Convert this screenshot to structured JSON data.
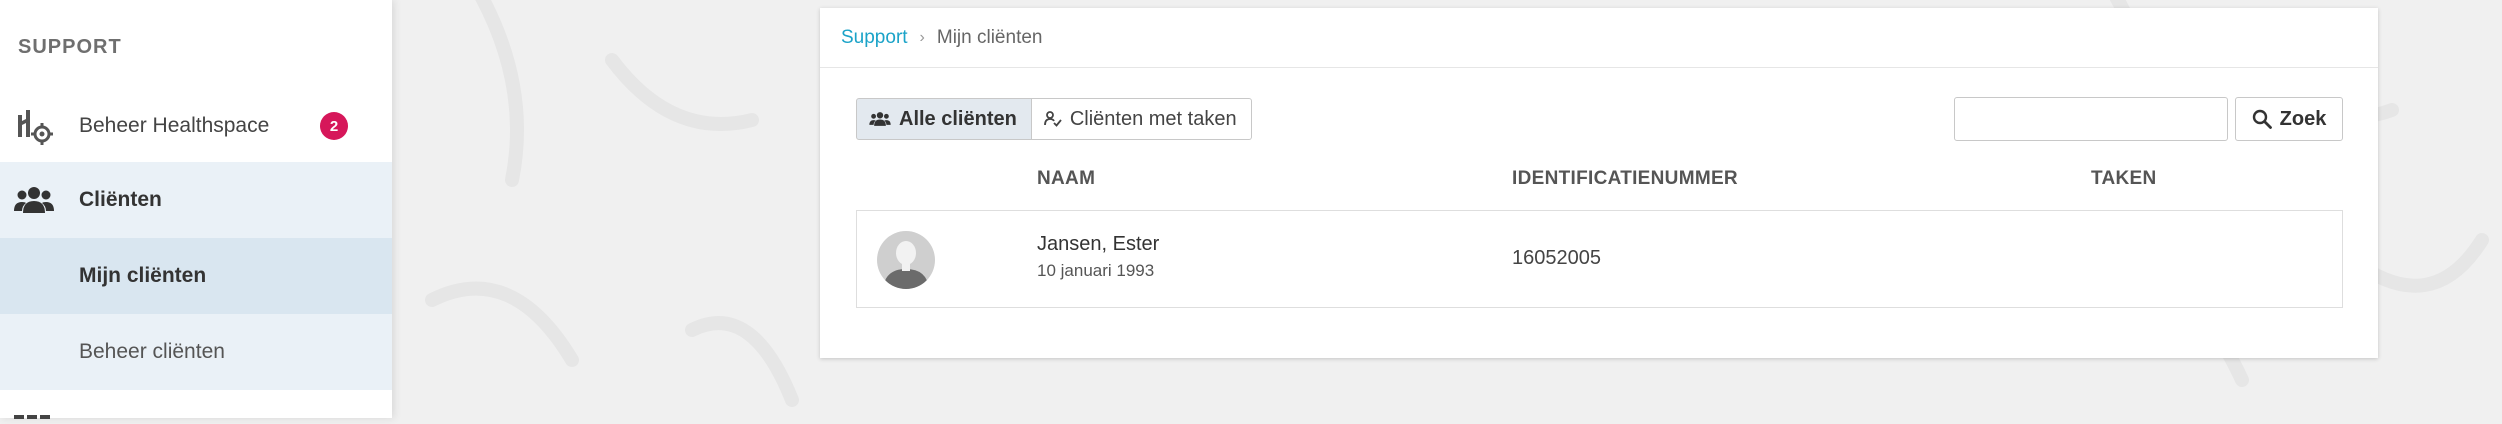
{
  "sidebar": {
    "heading": "SUPPORT",
    "items": [
      {
        "label": "Beheer Healthspace",
        "icon": "healthspace-gear-icon",
        "badge": "2"
      },
      {
        "label": "Cliënten",
        "icon": "users-icon"
      },
      {
        "label": "Mijn cliënten"
      },
      {
        "label": "Beheer cliënten"
      }
    ]
  },
  "breadcrumb": {
    "root": "Support",
    "separator": "›",
    "current": "Mijn cliënten"
  },
  "filters": {
    "all_label": "Alle cliënten",
    "tasks_label": "Cliënten met taken"
  },
  "search": {
    "placeholder": "",
    "value": "",
    "button_label": "Zoek"
  },
  "table": {
    "columns": [
      "NAAM",
      "IDENTIFICATIENUMMER",
      "TAKEN"
    ],
    "rows": [
      {
        "name": "Jansen, Ester",
        "dob": "10 januari 1993",
        "id": "16052005",
        "tasks": ""
      }
    ]
  },
  "colors": {
    "accent": "#1ba3c8",
    "badge": "#d6175a",
    "sidebar_active": "#d9e6f0",
    "sidebar_section": "#eaf1f7"
  }
}
